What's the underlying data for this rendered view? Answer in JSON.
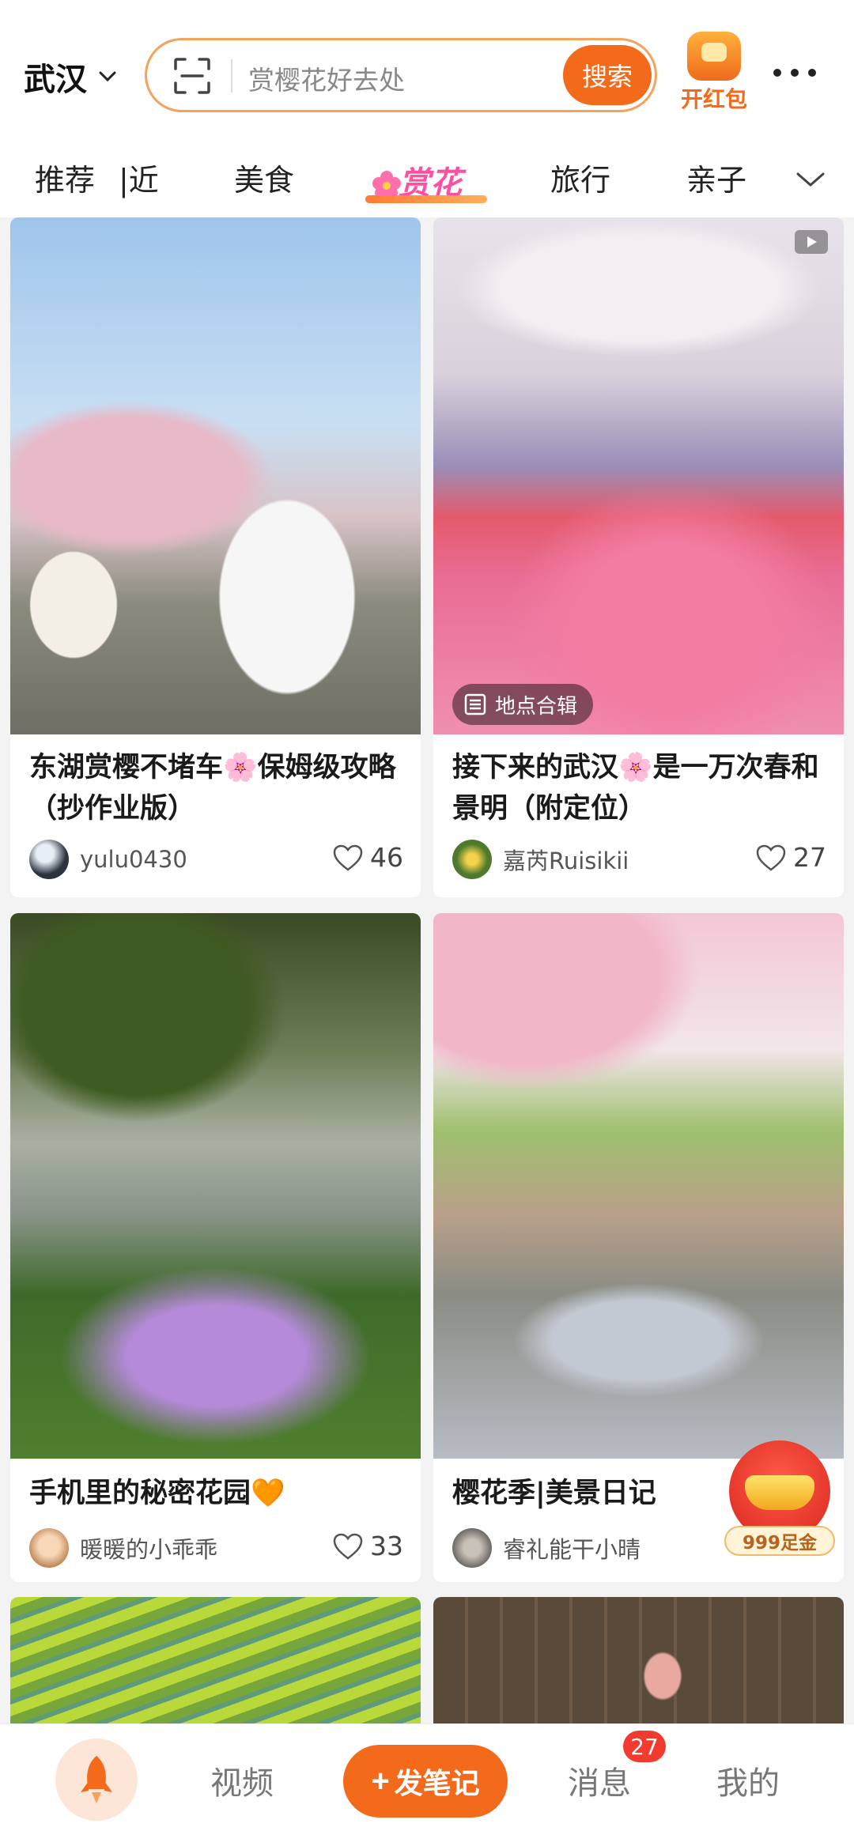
{
  "header": {
    "city": "武汉",
    "search_placeholder": "赏樱花好去处",
    "search_button": "搜索",
    "redpack_label": "开红包"
  },
  "tabs": {
    "items": [
      "推荐",
      "附近",
      "美食",
      "赏花",
      "旅行",
      "亲子"
    ],
    "visible_labels": [
      "推荐",
      "|近",
      "美食",
      "旅行",
      "亲子"
    ],
    "active": "赏花"
  },
  "feed": {
    "cards": [
      {
        "title": "东湖赏樱不堵车🌸保姆级攻略（抄作业版）",
        "author": "yulu0430",
        "likes": "46",
        "badge": ""
      },
      {
        "title": "接下来的武汉🌸是一万次春和景明（附定位）",
        "author": "嘉芮Ruisikii",
        "likes": "27",
        "badge": "地点合辑",
        "has_video": true
      },
      {
        "title": "手机里的秘密花园🧡",
        "author": "暖暖的小乖乖",
        "likes": "33"
      },
      {
        "title": "樱花季|美景日记",
        "author": "睿礼能干小晴",
        "likes": ""
      }
    ],
    "gold_float_label": "999足金"
  },
  "bottom_nav": {
    "video": "视频",
    "post": "发笔记",
    "messages": "消息",
    "messages_badge": "27",
    "me": "我的"
  },
  "colors": {
    "accent": "#f36a1a",
    "tab_active_text": "#ff4fa3",
    "badge_red": "#f23a2f"
  }
}
